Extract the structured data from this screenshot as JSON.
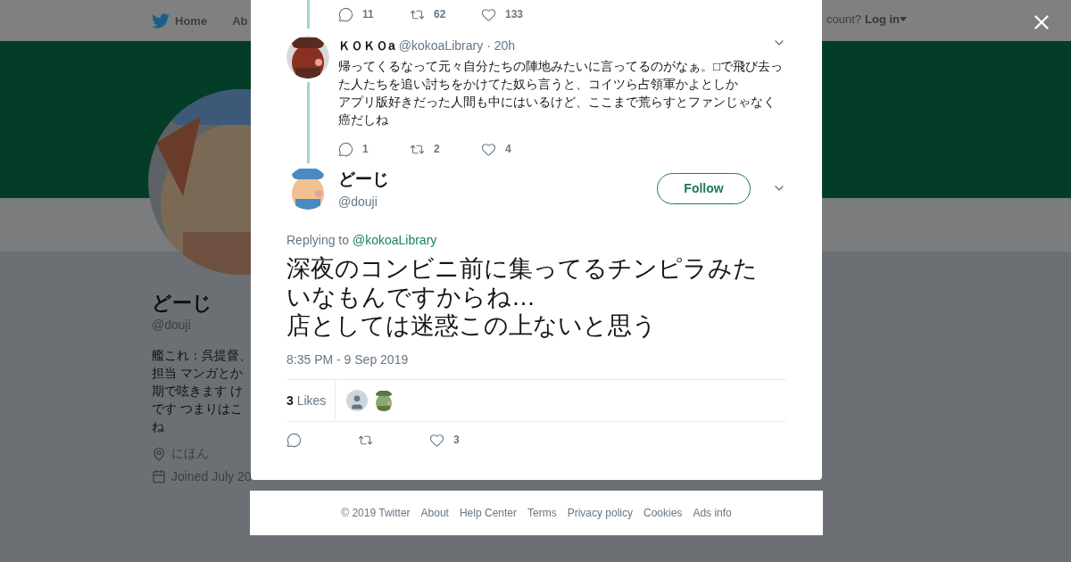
{
  "nav": {
    "items": [
      {
        "label": "Home"
      },
      {
        "label": "Ab"
      }
    ],
    "account_prompt": "count?",
    "login": "Log in"
  },
  "profile": {
    "name": "どーじ",
    "handle": "@douji",
    "bio_lines": [
      "艦これ：呉提督、",
      "担当 マンガとか",
      "期で呟きます け",
      "です つまりはこ",
      "ね"
    ],
    "location": "にほん",
    "joined": "Joined July 20"
  },
  "modal": {
    "previous_actions": {
      "replies": "11",
      "retweets": "62",
      "likes": "133"
    },
    "reply": {
      "name": "ＫＯＫＯa",
      "handle": "@kokoaLibrary",
      "time": "· 20h",
      "text_lines": [
        "帰ってくるなって元々自分たちの陣地みたいに言ってるのがなぁ。□で飛び去っ",
        "た人たちを追い討ちをかけてた奴ら言うと、コイツら占領軍かよとしか",
        "アプリ版好きだった人間も中にはいるけど、ここまで荒らすとファンじゃなく",
        "癌だしね"
      ],
      "replies": "1",
      "retweets": "2",
      "likes": "4"
    },
    "tweet": {
      "name": "どーじ",
      "handle": "@douji",
      "follow": "Follow",
      "replying_label": "Replying to",
      "replying_to": "@kokoaLibrary",
      "text_lines": [
        "深夜のコンビニ前に集ってるチンピラみた",
        "いなもんですからね…",
        "店としては迷惑この上ないと思う"
      ],
      "timestamp": "8:35 PM - 9 Sep 2019",
      "likes_summary": "**3** Likes",
      "likes": "3"
    }
  },
  "footer": {
    "links": [
      "© 2019 Twitter",
      "About",
      "Help Center",
      "Terms",
      "Privacy policy",
      "Cookies",
      "Ads info"
    ]
  }
}
